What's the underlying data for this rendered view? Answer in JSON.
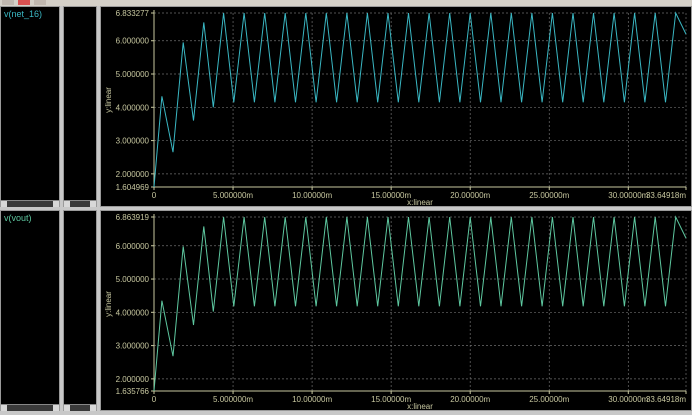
{
  "charts": [
    {
      "signal_label": "v(net_16)",
      "color": "#3ab8c4",
      "chart_data": {
        "type": "line",
        "series": [
          {
            "name": "v(net_16)"
          }
        ],
        "xlabel": "x:linear",
        "ylabel": "y:linear",
        "xlim": [
          0,
          33.64918
        ],
        "ylim": [
          1.604969,
          6.833277
        ],
        "x_unit": "m",
        "x_ticks": [
          "0",
          "5.000000m",
          "10.00000m",
          "15.00000m",
          "20.00000m",
          "25.00000m",
          "30.00000m",
          "33.64918m"
        ],
        "x_tick_values": [
          0,
          5,
          10,
          15,
          20,
          25,
          30,
          33.64918
        ],
        "y_ticks": [
          "1.604969",
          "2.000000",
          "3.000000",
          "4.000000",
          "5.000000",
          "6.000000",
          "6.833277"
        ],
        "y_tick_values": [
          1.604969,
          2,
          3,
          4,
          5,
          6,
          6.833277
        ],
        "grid": true,
        "x": [
          0,
          0.5,
          1.2,
          1.85,
          2.5,
          3.15,
          3.75,
          4.4,
          5.05,
          5.7,
          6.35,
          7.0,
          7.65,
          8.3,
          8.95,
          9.6,
          10.25,
          10.9,
          11.55,
          12.2,
          12.85,
          13.5,
          14.15,
          14.8,
          15.45,
          16.1,
          16.75,
          17.4,
          18.05,
          18.7,
          19.35,
          20.0,
          20.65,
          21.3,
          21.95,
          22.6,
          23.25,
          23.9,
          24.55,
          25.2,
          25.85,
          26.5,
          27.15,
          27.8,
          28.45,
          29.1,
          29.75,
          30.4,
          31.05,
          31.7,
          32.35,
          33.0,
          33.64918
        ],
        "values": [
          1.604969,
          4.33,
          2.65,
          5.95,
          3.6,
          6.55,
          4.0,
          6.833277,
          4.15,
          6.833277,
          4.15,
          6.833277,
          4.15,
          6.833277,
          4.15,
          6.833277,
          4.15,
          6.833277,
          4.15,
          6.833277,
          4.15,
          6.833277,
          4.15,
          6.833277,
          4.15,
          6.833277,
          4.15,
          6.833277,
          4.15,
          6.833277,
          4.15,
          6.833277,
          4.15,
          6.833277,
          4.15,
          6.833277,
          4.15,
          6.833277,
          4.15,
          6.833277,
          4.15,
          6.833277,
          4.15,
          6.833277,
          4.15,
          6.833277,
          4.15,
          6.833277,
          4.15,
          6.833277,
          4.15,
          6.833277,
          6.2
        ]
      }
    },
    {
      "signal_label": "v(vout)",
      "color": "#5ec8a0",
      "chart_data": {
        "type": "line",
        "series": [
          {
            "name": "v(vout)"
          }
        ],
        "xlabel": "x:linear",
        "ylabel": "y:linear",
        "xlim": [
          0,
          33.64918
        ],
        "ylim": [
          1.635766,
          6.863919
        ],
        "x_unit": "m",
        "x_ticks": [
          "0",
          "5.000000m",
          "10.00000m",
          "15.00000m",
          "20.00000m",
          "25.00000m",
          "30.00000m",
          "33.64918m"
        ],
        "x_tick_values": [
          0,
          5,
          10,
          15,
          20,
          25,
          30,
          33.64918
        ],
        "y_ticks": [
          "1.635766",
          "2.000000",
          "3.000000",
          "4.000000",
          "5.000000",
          "6.000000",
          "6.863919"
        ],
        "y_tick_values": [
          1.635766,
          2,
          3,
          4,
          5,
          6,
          6.863919
        ],
        "grid": true,
        "x": [
          0,
          0.5,
          1.2,
          1.85,
          2.5,
          3.15,
          3.75,
          4.4,
          5.05,
          5.7,
          6.35,
          7.0,
          7.65,
          8.3,
          8.95,
          9.6,
          10.25,
          10.9,
          11.55,
          12.2,
          12.85,
          13.5,
          14.15,
          14.8,
          15.45,
          16.1,
          16.75,
          17.4,
          18.05,
          18.7,
          19.35,
          20.0,
          20.65,
          21.3,
          21.95,
          22.6,
          23.25,
          23.9,
          24.55,
          25.2,
          25.85,
          26.5,
          27.15,
          27.8,
          28.45,
          29.1,
          29.75,
          30.4,
          31.05,
          31.7,
          32.35,
          33.0,
          33.64918
        ],
        "values": [
          1.635766,
          4.35,
          2.68,
          5.98,
          3.62,
          6.58,
          4.02,
          6.863919,
          4.18,
          6.863919,
          4.18,
          6.863919,
          4.18,
          6.863919,
          4.18,
          6.863919,
          4.18,
          6.863919,
          4.18,
          6.863919,
          4.18,
          6.863919,
          4.18,
          6.863919,
          4.18,
          6.863919,
          4.18,
          6.863919,
          4.18,
          6.863919,
          4.18,
          6.863919,
          4.18,
          6.863919,
          4.18,
          6.863919,
          4.18,
          6.863919,
          4.18,
          6.863919,
          4.18,
          6.863919,
          4.18,
          6.863919,
          4.18,
          6.863919,
          4.18,
          6.863919,
          4.18,
          6.863919,
          4.18,
          6.863919,
          6.23
        ]
      }
    }
  ],
  "colors": {
    "axis": "#c8c8a0",
    "grid": "#6e6e6e",
    "frame": "#9a9a9a",
    "background": "#000000"
  }
}
